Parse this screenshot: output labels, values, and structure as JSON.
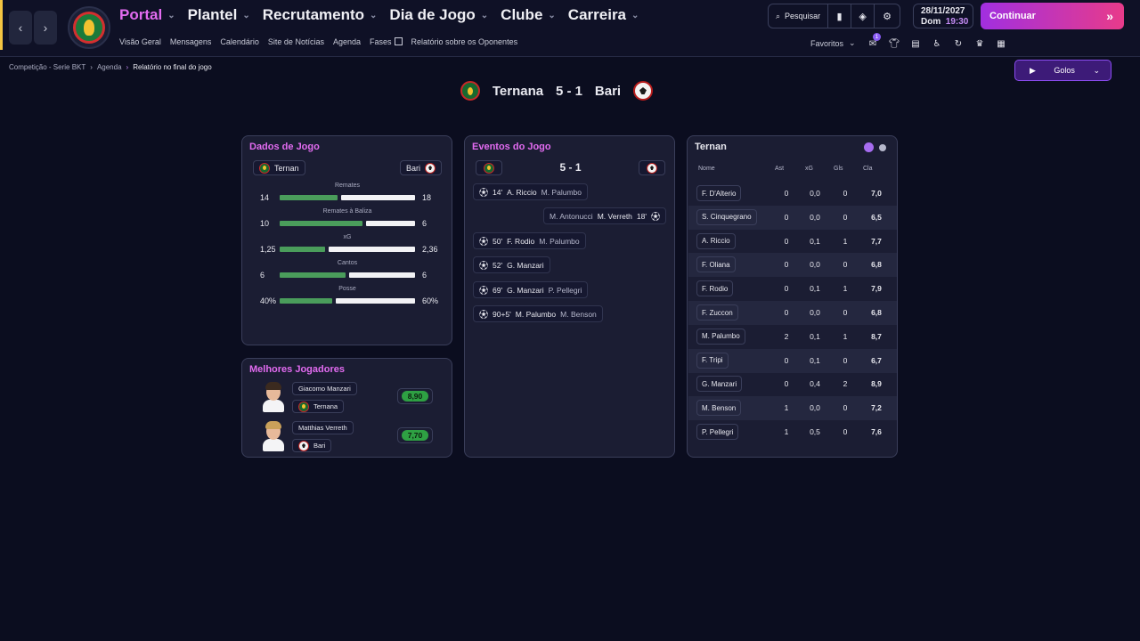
{
  "nav": {
    "main": [
      {
        "label": "Portal",
        "active": true
      },
      {
        "label": "Plantel",
        "active": false
      },
      {
        "label": "Recrutamento",
        "active": false
      },
      {
        "label": "Dia de Jogo",
        "active": false
      },
      {
        "label": "Clube",
        "active": false
      },
      {
        "label": "Carreira",
        "active": false
      }
    ],
    "sub": [
      "Visão Geral",
      "Mensagens",
      "Calendário",
      "Site de Notícias",
      "Agenda",
      "Fases",
      "Relatório sobre os Oponentes"
    ]
  },
  "toolbar": {
    "search_label": "Pesquisar",
    "favoritos_label": "Favoritos",
    "notification_count": "1"
  },
  "date": {
    "date": "28/11/2027",
    "day": "Dom",
    "time": "19:30"
  },
  "continue_label": "Continuar",
  "breadcrumb": [
    "Competição - Serie BKT",
    "Agenda",
    "Relatório no final do jogo"
  ],
  "golos_label": "Golos",
  "match": {
    "home": "Ternana",
    "away": "Bari",
    "score": "5 - 1"
  },
  "stats_panel": {
    "title": "Dados de Jogo",
    "home_team": "Ternan",
    "away_team": "Bari",
    "stats": [
      {
        "label": "Remates",
        "home": "14",
        "away": "18",
        "home_value": 14,
        "away_value": 18
      },
      {
        "label": "Remates à Baliza",
        "home": "10",
        "away": "6",
        "home_value": 10,
        "away_value": 6
      },
      {
        "label": "xG",
        "home": "1,25",
        "away": "2,36",
        "home_value": 1.25,
        "away_value": 2.36
      },
      {
        "label": "Cantos",
        "home": "6",
        "away": "6",
        "home_value": 6,
        "away_value": 6
      },
      {
        "label": "Posse",
        "home": "40%",
        "away": "60%",
        "home_value": 40,
        "away_value": 60
      }
    ]
  },
  "events_panel": {
    "title": "Eventos do Jogo",
    "score": "5 - 1",
    "events": [
      {
        "minute": "14'",
        "scorer": "A. Riccio",
        "assist": "M. Palumbo",
        "side": "home"
      },
      {
        "minute": "18'",
        "scorer": "M. Verreth",
        "assist": "M. Antonucci",
        "side": "away"
      },
      {
        "minute": "50'",
        "scorer": "F. Rodio",
        "assist": "M. Palumbo",
        "side": "home"
      },
      {
        "minute": "52'",
        "scorer": "G. Manzari",
        "assist": "",
        "side": "home"
      },
      {
        "minute": "69'",
        "scorer": "G. Manzari",
        "assist": "P. Pellegri",
        "side": "home"
      },
      {
        "minute": "90+5'",
        "scorer": "M. Palumbo",
        "assist": "M. Benson",
        "side": "home"
      }
    ]
  },
  "ratings_panel": {
    "title": "Ternan",
    "headers": [
      "Nome",
      "Ast",
      "xG",
      "Gls",
      "Cla"
    ],
    "rows": [
      {
        "name": "F. D'Alterio",
        "ast": "0",
        "xg": "0,0",
        "gls": "0",
        "cla": "7,0"
      },
      {
        "name": "S. Cinquegrano",
        "ast": "0",
        "xg": "0,0",
        "gls": "0",
        "cla": "6,5"
      },
      {
        "name": "A. Riccio",
        "ast": "0",
        "xg": "0,1",
        "gls": "1",
        "cla": "7,7"
      },
      {
        "name": "F. Oliana",
        "ast": "0",
        "xg": "0,0",
        "gls": "0",
        "cla": "6,8"
      },
      {
        "name": "F. Rodio",
        "ast": "0",
        "xg": "0,1",
        "gls": "1",
        "cla": "7,9"
      },
      {
        "name": "F. Zuccon",
        "ast": "0",
        "xg": "0,0",
        "gls": "0",
        "cla": "6,8"
      },
      {
        "name": "M. Palumbo",
        "ast": "2",
        "xg": "0,1",
        "gls": "1",
        "cla": "8,7"
      },
      {
        "name": "F. Tripi",
        "ast": "0",
        "xg": "0,1",
        "gls": "0",
        "cla": "6,7"
      },
      {
        "name": "G. Manzari",
        "ast": "0",
        "xg": "0,4",
        "gls": "2",
        "cla": "8,9"
      },
      {
        "name": "M. Benson",
        "ast": "1",
        "xg": "0,0",
        "gls": "0",
        "cla": "7,2"
      },
      {
        "name": "P. Pellegri",
        "ast": "1",
        "xg": "0,5",
        "gls": "0",
        "cla": "7,6"
      }
    ]
  },
  "best_players": {
    "title": "Melhores Jogadores",
    "players": [
      {
        "name": "Giacomo Manzari",
        "team": "Ternana",
        "rating": "8,90",
        "hair": "#3b2a1f"
      },
      {
        "name": "Matthias Verreth",
        "team": "Bari",
        "rating": "7,70",
        "hair": "#c9a05a"
      }
    ]
  },
  "colors": {
    "accent": "#e26bf0",
    "continue_start": "#a12fe0",
    "continue_end": "#e83b8a",
    "bar_home": "#4a9d5b",
    "bar_away": "#f2f2f5",
    "rating_good": "#2ea043"
  }
}
